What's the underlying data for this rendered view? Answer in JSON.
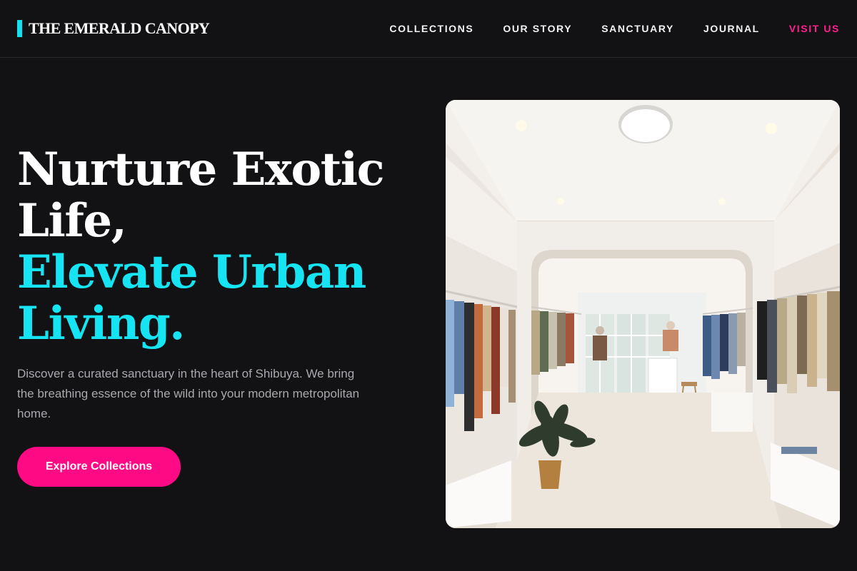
{
  "brand": {
    "name": "THE EMERALD CANOPY",
    "accent_color": "#14e0f0"
  },
  "nav": {
    "items": [
      {
        "label": "COLLECTIONS"
      },
      {
        "label": "OUR STORY"
      },
      {
        "label": "SANCTUARY"
      },
      {
        "label": "JOURNAL"
      },
      {
        "label": "VISIT US",
        "highlight": true
      }
    ],
    "highlight_color": "#ff1f8e"
  },
  "hero": {
    "headline_white": "Nurture Exotic Life,",
    "headline_cyan": "Elevate Urban Living.",
    "headline_cyan_color": "#16e4f2",
    "description": "Discover a curated sanctuary in the heart of Shibuya. We bring the breathing essence of the wild into your modern metropolitan home.",
    "cta_label": "Explore Collections",
    "cta_color": "#ff0a85",
    "image": {
      "subject": "bright white boutique clothing store interior with clothing racks, potted plant and arched doorway"
    }
  },
  "colors": {
    "background": "#121113",
    "text_muted": "#a9a9ae"
  }
}
